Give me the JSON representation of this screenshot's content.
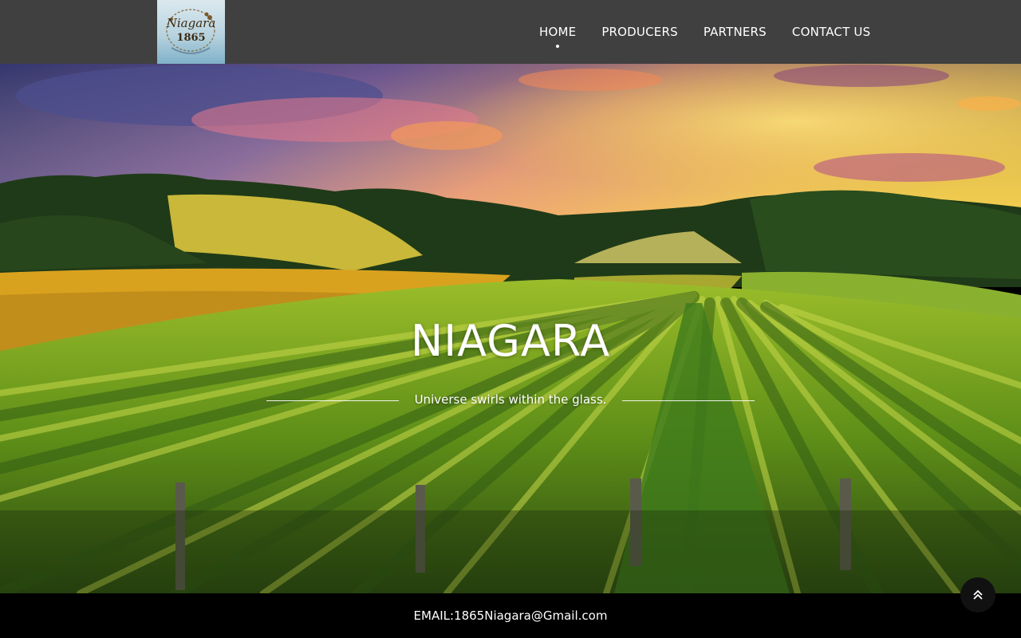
{
  "brand": {
    "logo_script": "Niagara",
    "logo_year": "1865"
  },
  "nav": {
    "items": [
      {
        "label": "HOME",
        "active": true
      },
      {
        "label": "PRODUCERS",
        "active": false
      },
      {
        "label": "PARTNERS",
        "active": false
      },
      {
        "label": "CONTACT US",
        "active": false
      }
    ]
  },
  "hero": {
    "title": "NIAGARA",
    "tagline": "Universe swirls within the glass."
  },
  "footer": {
    "contact": "EMAIL:1865Niagara@Gmail.com"
  },
  "icons": {
    "back_to_top": "double-chevron-up-icon"
  },
  "colors": {
    "header_bg": "#404040",
    "footer_bg": "#000000",
    "text": "#ffffff"
  }
}
